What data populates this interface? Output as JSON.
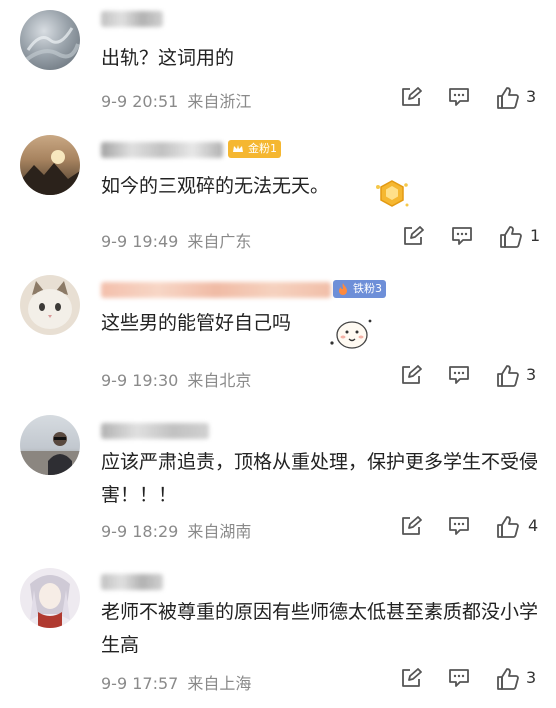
{
  "comments": [
    {
      "text": "出轨？这词用的",
      "time": "9-9 20:51",
      "location": "来自浙江",
      "likes": "3"
    },
    {
      "badge": "金粉1",
      "text": "如今的三观碎的无法无天。",
      "time": "9-9 19:49",
      "location": "来自广东",
      "likes": "1"
    },
    {
      "badge": "铁粉3",
      "text": "这些男的能管好自己吗",
      "time": "9-9 19:30",
      "location": "来自北京",
      "likes": "3"
    },
    {
      "text": "应该严肃追责，顶格从重处理，保护更多学生不受侵害！！！",
      "time": "9-9 18:29",
      "location": "来自湖南",
      "likes": "4"
    },
    {
      "text": "老师不被尊重的原因有些师德太低甚至素质都没小学生高",
      "time": "9-9 17:57",
      "location": "来自上海",
      "likes": "3"
    }
  ],
  "icons": {
    "repost": "edit-icon",
    "comment": "comment-icon",
    "like": "thumbs-up-icon",
    "sticker": "emoji-sticker-icon"
  },
  "colors": {
    "gold_badge": "#f5b731",
    "iron_badge": "#6e8fd8",
    "meta_text": "#8a8a8a",
    "icon_gray": "#555555"
  }
}
